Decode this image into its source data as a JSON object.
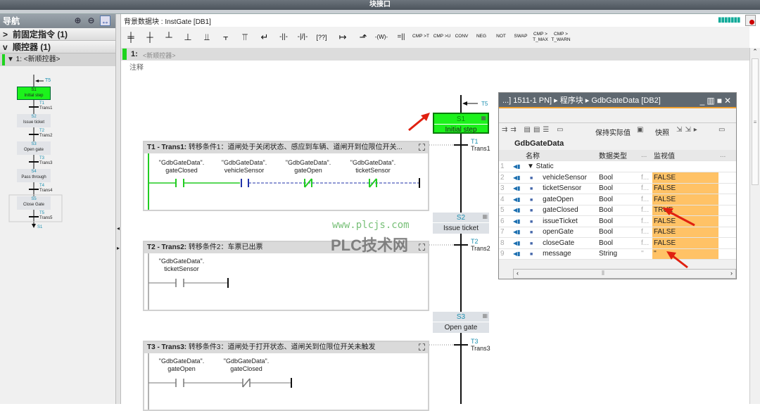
{
  "window": {
    "title": "块接口"
  },
  "nav": {
    "title": "导航",
    "rows": [
      {
        "chevron": ">",
        "label": "前固定指令 (1)"
      },
      {
        "chevron": "v",
        "label": "顺控器 (1)"
      }
    ],
    "sub": "▼ 1: <新顺控器>",
    "mini": {
      "top_jump": "T5",
      "steps": [
        {
          "num": "S1",
          "name": "Initial step"
        },
        {
          "num": "S2",
          "name": "Issue ticket"
        },
        {
          "num": "S3",
          "name": "Open gate"
        },
        {
          "num": "S4",
          "name": "Pass through"
        },
        {
          "num": "S5",
          "name": "Close Gate"
        }
      ],
      "trans": [
        {
          "t": "T1",
          "n": "Trans1"
        },
        {
          "t": "T2",
          "n": "Trans2"
        },
        {
          "t": "T3",
          "n": "Trans3"
        },
        {
          "t": "T4",
          "n": "Trans4"
        },
        {
          "t": "T5",
          "n": "Trans5"
        }
      ],
      "bottom_jump": "S1"
    }
  },
  "main": {
    "instance_db_label": "背景数据块",
    "instance_db_value": "InstGate [DB1]",
    "toolbar_text": [
      "CMP >T",
      "CMP >U",
      "CONV",
      "NEG",
      "NOT",
      "SWAP",
      "CMP > T_MAX",
      "CMP > T_WARN"
    ],
    "network": {
      "num": "1:",
      "name": "<新顺控器>",
      "comment": "注释"
    }
  },
  "chain": {
    "top_jump": "T5",
    "steps": [
      {
        "num": "S1",
        "name": "Initial step"
      },
      {
        "num": "S2",
        "name": "Issue ticket"
      },
      {
        "num": "S3",
        "name": "Open gate"
      }
    ],
    "trans": [
      {
        "t": "T1",
        "n": "Trans1"
      },
      {
        "t": "T2",
        "n": "Trans2"
      },
      {
        "t": "T3",
        "n": "Trans3"
      }
    ]
  },
  "transitions": [
    {
      "title": "T1 - Trans1:",
      "comment": "转移条件1：道闸处于关闭状态、感应到车辆、道闸开到位限位开关...",
      "ops": [
        {
          "db": "\"GdbGateData\".",
          "tag": "gateClosed"
        },
        {
          "db": "\"GdbGateData\".",
          "tag": "vehicleSensor"
        },
        {
          "db": "\"GdbGateData\".",
          "tag": "gateOpen"
        },
        {
          "db": "\"GdbGateData\".",
          "tag": "ticketSensor"
        }
      ]
    },
    {
      "title": "T2 - Trans2:",
      "comment": "转移条件2：车票已出票",
      "ops": [
        {
          "db": "\"GdbGateData\".",
          "tag": "ticketSensor"
        }
      ]
    },
    {
      "title": "T3 - Trans3:",
      "comment": "转移条件3：道闸处于打开状态、道闸关到位限位开关未触发",
      "ops": [
        {
          "db": "\"GdbGateData\".",
          "tag": "gateOpen"
        },
        {
          "db": "\"GdbGateData\".",
          "tag": "gateClosed"
        }
      ]
    }
  ],
  "watermark": {
    "url": "www.plcjs.com",
    "name": "PLC技术网"
  },
  "db_window": {
    "path": "...] 1511-1 PN] ▸ 程序块 ▸ GdbGateData [DB2]",
    "keep_actual": "保持实际值",
    "snapshot": "快照",
    "db_name": "GdbGateData",
    "headers": [
      "名称",
      "数据类型",
      "...",
      "监视值",
      "..."
    ],
    "rows": [
      {
        "n": "1",
        "name": "▼ Static",
        "type": "",
        "d": "",
        "val": ""
      },
      {
        "n": "2",
        "name": "vehicleSensor",
        "type": "Bool",
        "d": "f...",
        "val": "FALSE"
      },
      {
        "n": "3",
        "name": "ticketSensor",
        "type": "Bool",
        "d": "f...",
        "val": "FALSE"
      },
      {
        "n": "4",
        "name": "gateOpen",
        "type": "Bool",
        "d": "f...",
        "val": "FALSE"
      },
      {
        "n": "5",
        "name": "gateClosed",
        "type": "Bool",
        "d": "f...",
        "val": "TRUE"
      },
      {
        "n": "6",
        "name": "issueTicket",
        "type": "Bool",
        "d": "f...",
        "val": "FALSE"
      },
      {
        "n": "7",
        "name": "openGate",
        "type": "Bool",
        "d": "f...",
        "val": "FALSE"
      },
      {
        "n": "8",
        "name": "closeGate",
        "type": "Bool",
        "d": "f...",
        "val": "FALSE"
      },
      {
        "n": "9",
        "name": "message",
        "type": "String",
        "d": "''",
        "val": "''"
      }
    ]
  },
  "colors": {
    "active_step": "#1cf21c",
    "monitor": "#ffc266",
    "accent": "#1c8fb0"
  }
}
